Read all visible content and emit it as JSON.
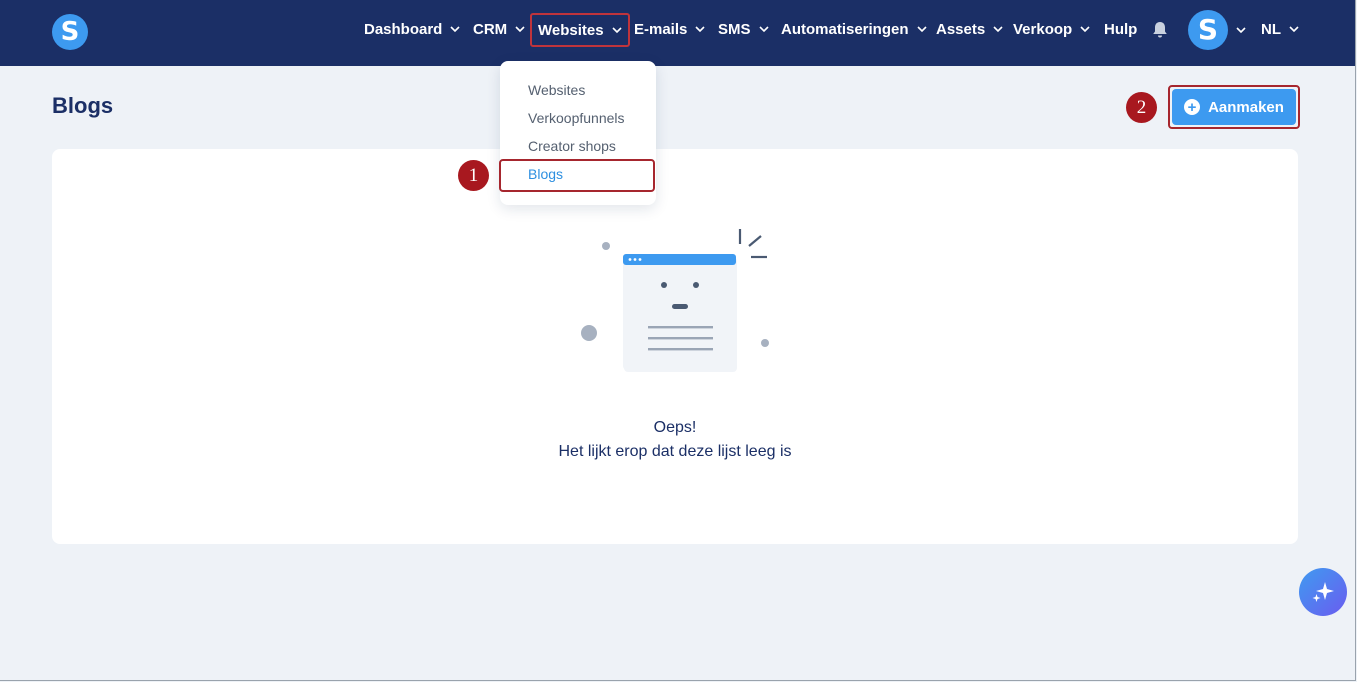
{
  "app": {
    "logo_letter": "S",
    "avatar_letter": "S"
  },
  "nav": {
    "items": [
      {
        "label": "Dashboard"
      },
      {
        "label": "CRM"
      },
      {
        "label": "Websites"
      },
      {
        "label": "E-mails"
      },
      {
        "label": "SMS"
      },
      {
        "label": "Automatiseringen"
      },
      {
        "label": "Assets"
      },
      {
        "label": "Verkoop"
      },
      {
        "label": "Hulp"
      }
    ],
    "active": "Websites",
    "language": "NL"
  },
  "dropdown": {
    "items": [
      {
        "label": "Websites"
      },
      {
        "label": "Verkoopfunnels"
      },
      {
        "label": "Creator shops"
      },
      {
        "label": "Blogs"
      }
    ],
    "active": "Blogs"
  },
  "markers": {
    "one": "1",
    "two": "2"
  },
  "page": {
    "title": "Blogs",
    "create_label": "Aanmaken"
  },
  "empty_state": {
    "title": "Oeps!",
    "subtitle": "Het lijkt erop dat deze lijst leeg is"
  },
  "colors": {
    "nav_bg": "#1b2f66",
    "accent": "#3d9af0",
    "marker": "#a8181f",
    "page_bg": "#eef2f7"
  }
}
